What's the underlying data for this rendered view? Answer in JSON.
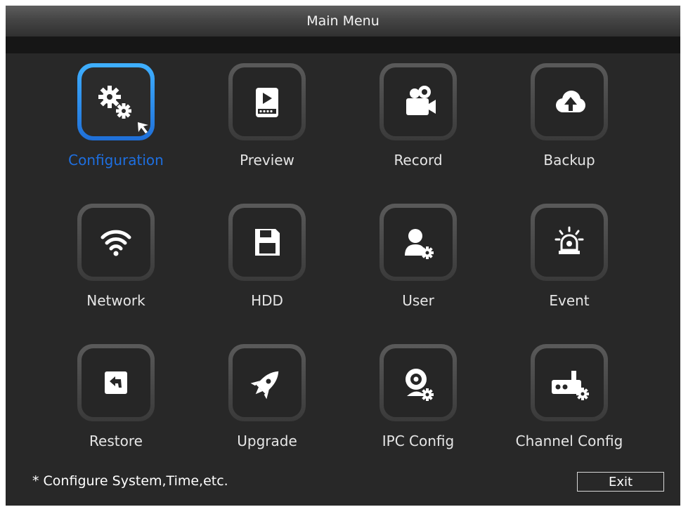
{
  "window": {
    "title": "Main Menu"
  },
  "menu": {
    "selected_index": 0,
    "items": [
      {
        "label": "Configuration",
        "icon": "gears-cursor-icon"
      },
      {
        "label": "Preview",
        "icon": "video-player-icon"
      },
      {
        "label": "Record",
        "icon": "video-camera-icon"
      },
      {
        "label": "Backup",
        "icon": "cloud-upload-icon"
      },
      {
        "label": "Network",
        "icon": "wifi-icon"
      },
      {
        "label": "HDD",
        "icon": "floppy-disk-icon"
      },
      {
        "label": "User",
        "icon": "user-gear-icon"
      },
      {
        "label": "Event",
        "icon": "alarm-light-icon"
      },
      {
        "label": "Restore",
        "icon": "restore-arrow-icon"
      },
      {
        "label": "Upgrade",
        "icon": "rocket-icon"
      },
      {
        "label": "IPC Config",
        "icon": "webcam-gear-icon"
      },
      {
        "label": "Channel Config",
        "icon": "channel-device-gear-icon"
      }
    ]
  },
  "footer": {
    "hint": "* Configure System,Time,etc.",
    "exit_label": "Exit"
  },
  "colors": {
    "selected_accent": "#1e6fe0",
    "frame_border": "#5a5a5a",
    "background": "#282828"
  }
}
